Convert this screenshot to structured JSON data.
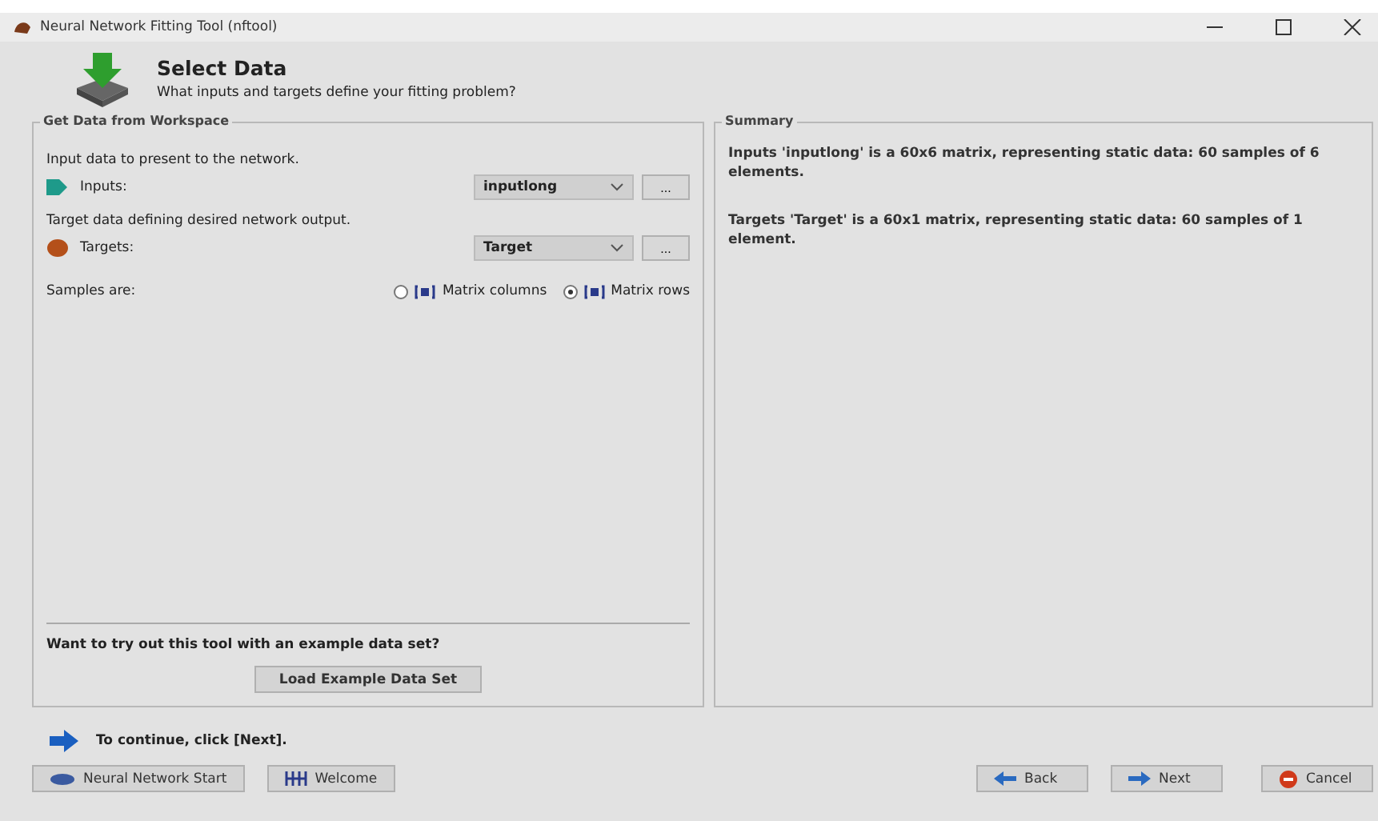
{
  "window": {
    "title": "Neural Network Fitting Tool (nftool)"
  },
  "header": {
    "title": "Select Data",
    "subtitle": "What inputs and targets define your fitting problem?"
  },
  "workspace_panel": {
    "title": "Get Data from Workspace",
    "fields": [
      {
        "kind": "inputs",
        "description": "Input data to present to the network.",
        "label": "Inputs:",
        "value": "inputlong",
        "browse": "..."
      },
      {
        "kind": "targets",
        "description": "Target data defining desired network output.",
        "label": "Targets:",
        "value": "Target",
        "browse": "..."
      }
    ],
    "samples": {
      "label": "Samples are:",
      "options": [
        {
          "label": "Matrix columns",
          "selected": false
        },
        {
          "label": "Matrix rows",
          "selected": true
        }
      ]
    },
    "example_prompt": "Want to try out this tool with an example data set?",
    "example_button": "Load Example Data Set"
  },
  "summary_panel": {
    "title": "Summary",
    "lines": [
      "Inputs 'inputlong' is a 60x6 matrix, representing static data: 60 samples of 6 elements.",
      "Targets 'Target' is a 60x1 matrix, representing static data: 60 samples of 1 element."
    ]
  },
  "hint": "To continue, click [Next].",
  "nav_buttons": [
    {
      "kind": "start",
      "label": "Neural Network Start"
    },
    {
      "kind": "welcome",
      "label": "Welcome"
    }
  ],
  "wizard_buttons": [
    {
      "kind": "back",
      "label": "Back"
    },
    {
      "kind": "next",
      "label": "Next"
    },
    {
      "kind": "cancel",
      "label": "Cancel"
    }
  ]
}
